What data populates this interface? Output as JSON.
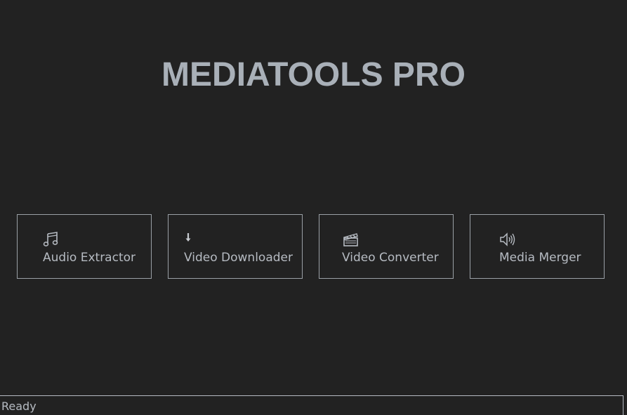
{
  "app": {
    "title": "MEDIATOOLS PRO"
  },
  "tools": [
    {
      "label": "Audio Extractor",
      "icon": "music-note-icon"
    },
    {
      "label": "Video Downloader",
      "icon": "download-arrow-icon"
    },
    {
      "label": "Video Converter",
      "icon": "clapperboard-icon"
    },
    {
      "label": "Media Merger",
      "icon": "speaker-icon"
    }
  ],
  "status": {
    "text": "Ready"
  },
  "colors": {
    "background": "#222222",
    "title": "#a9b0b8",
    "text": "#b6bbc2",
    "border": "#9aa0a6"
  }
}
